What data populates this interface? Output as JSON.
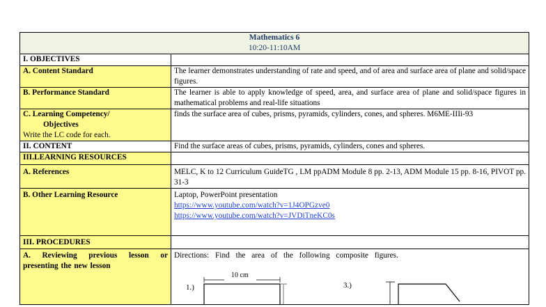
{
  "header": {
    "subject": "Mathematics 6",
    "time": "10:20-11:10AM"
  },
  "rows": {
    "objectives": "I. OBJECTIVES",
    "content_standard": {
      "label": "A. Content Standard",
      "text": "The learner demonstrates understanding of rate and speed, and of area and surface area of plane and solid/space figures."
    },
    "performance_standard": {
      "label": "B. Performance Standard",
      "text": "The learner is able to apply knowledge of speed, area, and surface area of plane and solid/space figures in mathematical problems and real-life situations"
    },
    "competency": {
      "label_line1": "C. Learning Competency/",
      "label_line2": "Objectives",
      "label_line3": "Write the LC code for each.",
      "text": "finds the surface area of cubes, prisms, pyramids, cylinders, cones, and spheres. M6ME-IIIi-93"
    },
    "content": {
      "label": "II. CONTENT",
      "text": "Find the surface areas of cubes, prisms, pyramids, cylinders, cones and spheres."
    },
    "learning_resources": "III.LEARNING RESOURCES",
    "references": {
      "label": "A. References",
      "text": "MELC, K to 12 Curriculum GuideTG , LM ppADM Module 8 pp. 2-13, ADM Module 15 pp. 8-16, PIVOT pp. 31-3"
    },
    "other_resources": {
      "label": "B. Other Learning Resource",
      "line1": "Laptop, PowerPoint presentation",
      "link1": "https://www.youtube.com/watch?v=1J4OPGzve0",
      "link2": "https://www.youtube.com/watch?v=JVDiTneKC0s"
    },
    "procedures": "III.  PROCEDURES",
    "reviewing": {
      "label": "A. Reviewing previous lesson or presenting the new lesson",
      "directions": "Directions:  Find  the  area  of the following composite figures.",
      "figure1_number": "1.)",
      "figure1_dimension": "10 cm",
      "figure3_number": "3.)"
    }
  }
}
